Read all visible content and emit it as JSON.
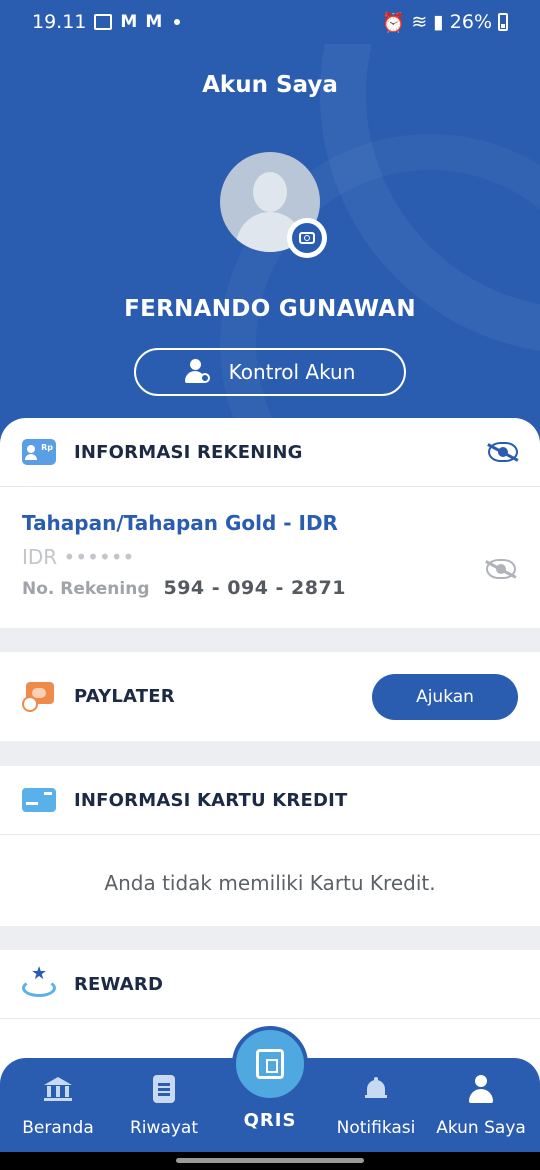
{
  "status_bar": {
    "time": "19.11",
    "battery": "26%"
  },
  "header": {
    "title": "Akun Saya",
    "user_name": "FERNANDO GUNAWAN",
    "kontrol_label": "Kontrol Akun"
  },
  "rekening": {
    "title": "INFORMASI REKENING",
    "account_name": "Tahapan/Tahapan Gold - IDR",
    "balance_masked": "IDR ••••••",
    "account_number_label": "No. Rekening",
    "account_number": "594 - 094 - 2871"
  },
  "paylater": {
    "title": "PAYLATER",
    "button_label": "Ajukan"
  },
  "kartu_kredit": {
    "title": "INFORMASI KARTU KREDIT",
    "empty_message": "Anda tidak memiliki Kartu Kredit."
  },
  "reward": {
    "title": "REWARD"
  },
  "bottom_nav": {
    "items": [
      {
        "label": "Beranda",
        "icon": "bank-icon"
      },
      {
        "label": "Riwayat",
        "icon": "document-icon"
      },
      {
        "label": "QRIS",
        "icon": "qris-icon"
      },
      {
        "label": "Notifikasi",
        "icon": "bell-icon"
      },
      {
        "label": "Akun Saya",
        "icon": "user-icon"
      }
    ]
  },
  "colors": {
    "primary": "#2a5db0",
    "accent_orange": "#f08a4b",
    "accent_light_blue": "#5ab0e8",
    "background": "#eceef2"
  }
}
